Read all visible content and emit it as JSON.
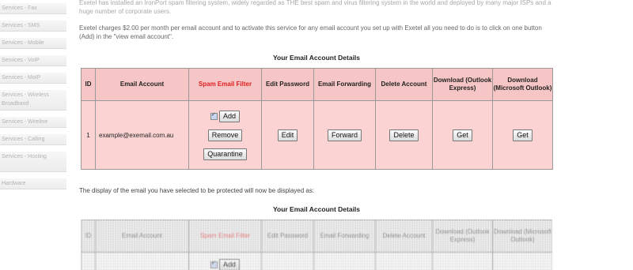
{
  "sidebar": {
    "items": [
      "Services - Fax",
      "Services - SMS",
      "Services - Mobile",
      "Services - VoIP",
      "Services - MoIP",
      "Services - Wireless Broadband",
      "Services - Wireline",
      "Services - Calling",
      "Services - Hosting",
      "Hardware"
    ]
  },
  "intro": {
    "faded_text": "Exetel has installed an IronPort spam filtering system, widely regarded as THE best spam and virus filtering system in the world and deployed by many major ISPs and a huge number of corporate users.",
    "charges_text": "Exetel charges $2.00 per month per email account and to activate this service for any email account you set up with Exetel all you need to do is to click on one button (Add) in the \"view email account\".",
    "display_text": "The display of the email you have selected to be protected will now be displayed as:"
  },
  "section_title": "Your Email Account Details",
  "table": {
    "headers": [
      "ID",
      "Email Account",
      "Spam Email Filter",
      "Edit Password",
      "Email Forwarding",
      "Delete Account",
      "Download (Outlook Express)",
      "Download (Microsoft Outlook)"
    ],
    "row": {
      "id": "1",
      "email": "example@exemail.com.au",
      "add": "Add",
      "remove": "Remove",
      "quarantine": "Quarantine",
      "edit": "Edit",
      "forward": "Forward",
      "delete": "Delete",
      "get1": "Get",
      "get2": "Get"
    }
  },
  "table2": {
    "add": "Add"
  }
}
